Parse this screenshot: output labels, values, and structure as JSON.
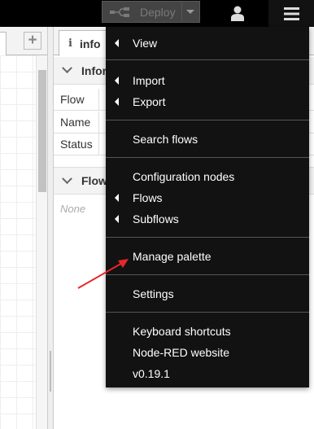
{
  "header": {
    "deploy_label": "Deploy",
    "icons": [
      "deploy-icon",
      "chevron-down-icon",
      "user-icon",
      "hamburger-menu-icon"
    ]
  },
  "workspace": {
    "add_tab_label": "+"
  },
  "sidebar": {
    "tab_label": "info",
    "section_info_title": "Infor",
    "rows": [
      "Flow",
      "Name",
      "Status"
    ],
    "section_flows_title": "Flow",
    "none_label": "None"
  },
  "menu": {
    "items": [
      {
        "label": "View",
        "submenu": true
      },
      {
        "label": "Import",
        "submenu": true
      },
      {
        "label": "Export",
        "submenu": true
      },
      {
        "label": "Search flows",
        "submenu": false
      },
      {
        "label": "Configuration nodes",
        "submenu": false
      },
      {
        "label": "Flows",
        "submenu": true
      },
      {
        "label": "Subflows",
        "submenu": true
      },
      {
        "label": "Manage palette",
        "submenu": false
      },
      {
        "label": "Settings",
        "submenu": false
      },
      {
        "label": "Keyboard shortcuts",
        "submenu": false
      },
      {
        "label": "Node-RED website",
        "submenu": false
      },
      {
        "label": "v0.19.1",
        "submenu": false
      }
    ]
  },
  "colors": {
    "header_bg": "#000000",
    "menu_bg": "#121212",
    "annotation_arrow": "#e8262b"
  }
}
